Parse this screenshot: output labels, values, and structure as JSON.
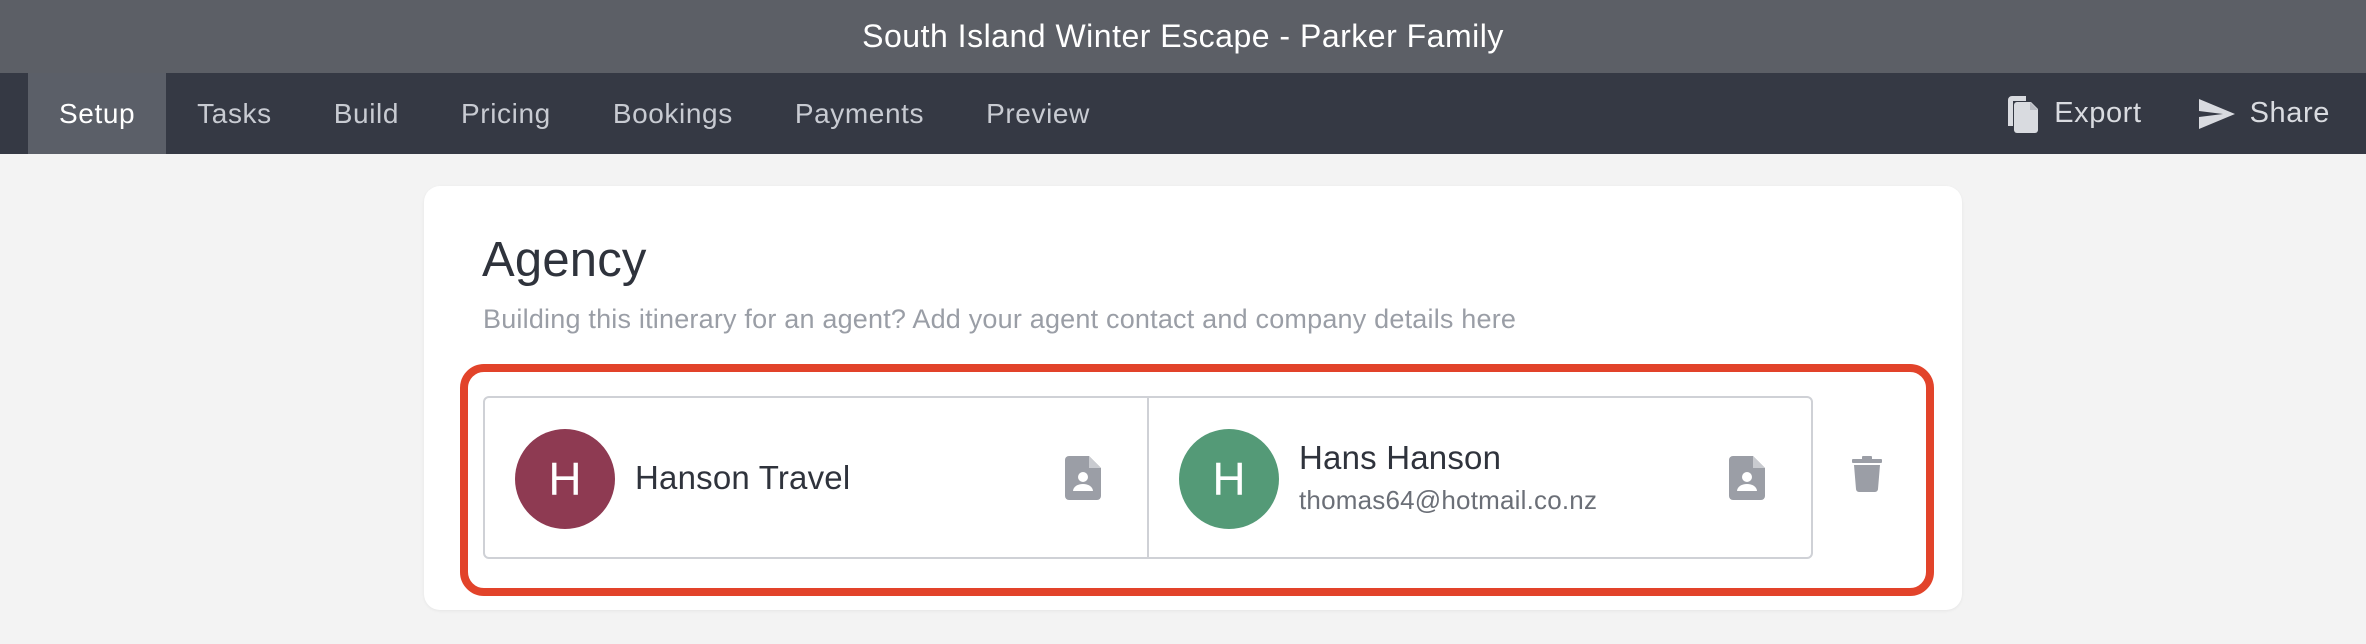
{
  "window": {
    "title": "South Island Winter Escape - Parker Family"
  },
  "nav": {
    "tabs": [
      {
        "label": "Setup",
        "active": true
      },
      {
        "label": "Tasks"
      },
      {
        "label": "Build"
      },
      {
        "label": "Pricing"
      },
      {
        "label": "Bookings"
      },
      {
        "label": "Payments"
      },
      {
        "label": "Preview"
      }
    ],
    "actions": {
      "export": {
        "label": "Export",
        "icon": "copy-document-icon"
      },
      "share": {
        "label": "Share",
        "icon": "send-icon"
      }
    }
  },
  "agency": {
    "title": "Agency",
    "subtitle": "Building this itinerary for an agent? Add your agent contact and company details here",
    "company": {
      "initial": "H",
      "name": "Hanson Travel",
      "avatar_color": "#8e3a52",
      "icon": "contact-document-icon"
    },
    "agent": {
      "initial": "H",
      "name": "Hans Hanson",
      "email": "thomas64@hotmail.co.nz",
      "avatar_color": "#549a77",
      "icon": "contact-document-icon"
    },
    "delete_icon": "trash-icon"
  },
  "colors": {
    "titlebar": "#5c5f66",
    "navbar": "#353944",
    "active_tab": "#5b5f68",
    "highlight_border": "#e2432a"
  }
}
